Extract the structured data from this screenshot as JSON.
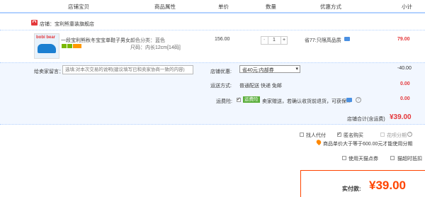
{
  "header": {
    "col_shop_item": "店铺宝贝",
    "col_attrs": "商品属性",
    "col_price": "单价",
    "col_qty": "数量",
    "col_discount": "优惠方式",
    "col_subtotal": "小计"
  },
  "shop": {
    "label": "店铺：",
    "name": "宝利熊童装旗舰店"
  },
  "item": {
    "thumb_brand": "bobi bear",
    "title": "一段宝利熊秋冬宝宝单鞋子男女...",
    "color_label": "颜色分类：蓝色",
    "size_label": "尺码：内长12cm[14码]",
    "price": "156.00",
    "qty": "1",
    "minus": "-",
    "plus": "+",
    "discount": "省77:只限高品质",
    "subtotal": "79.00"
  },
  "message": {
    "label": "给卖家留言：",
    "placeholder": "选填:对本次交易的说明(建议填写已和卖家协商一致的内容)"
  },
  "shop_discount": {
    "label": "店铺优惠:",
    "select": "省40元:内部券",
    "amount": "-40.00"
  },
  "shipping": {
    "label": "运送方式:",
    "value": "普通配送 快递 免邮",
    "amount": "0.00"
  },
  "insurance": {
    "label": "运费险:",
    "tag": "运费险",
    "text": "卖家赠送，若确认收货前退货，可获保...",
    "amount": "0.00"
  },
  "shop_total": {
    "label": "店铺合计(含运费)",
    "value": "¥39.00"
  },
  "options": {
    "proxy": "找人代付",
    "anonymous": "匿名购买",
    "huabei": "花呗分期",
    "note": "商品单价大于等于600.00元才能使用分期",
    "tmall_points": "使用天猫点券",
    "tmall_invoice": "猫超时抵扣"
  },
  "payment": {
    "label": "实付款:",
    "value": "¥39.00"
  },
  "colors": {
    "accent": "#ff4400",
    "price_red": "#c40000",
    "header_bg": "#ffffff",
    "panel_bg": "#f2f7ff",
    "border_blue": "#b2d1ff"
  }
}
